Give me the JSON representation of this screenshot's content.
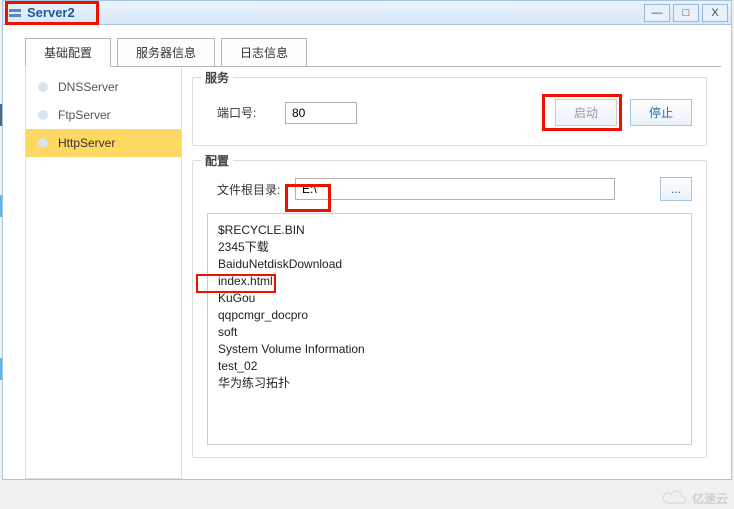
{
  "window": {
    "title": "Server2",
    "min": "—",
    "max": "□",
    "close": "X"
  },
  "tabs": {
    "basic": "基础配置",
    "server_info": "服务器信息",
    "log_info": "日志信息"
  },
  "sidebar": {
    "dns": "DNSServer",
    "ftp": "FtpServer",
    "http": "HttpServer"
  },
  "service": {
    "legend": "服务",
    "port_label": "端口号:",
    "port_value": "80",
    "start": "启动",
    "stop": "停止"
  },
  "config": {
    "legend": "配置",
    "root_label": "文件根目录:",
    "root_value": "E:\\",
    "browse": "...",
    "files": [
      "$RECYCLE.BIN",
      "2345下载",
      "BaiduNetdiskDownload",
      "index.html",
      "KuGou",
      "qqpcmgr_docpro",
      "soft",
      "System Volume Information",
      "test_02",
      "华为练习拓扑"
    ]
  },
  "watermark": "亿速云"
}
